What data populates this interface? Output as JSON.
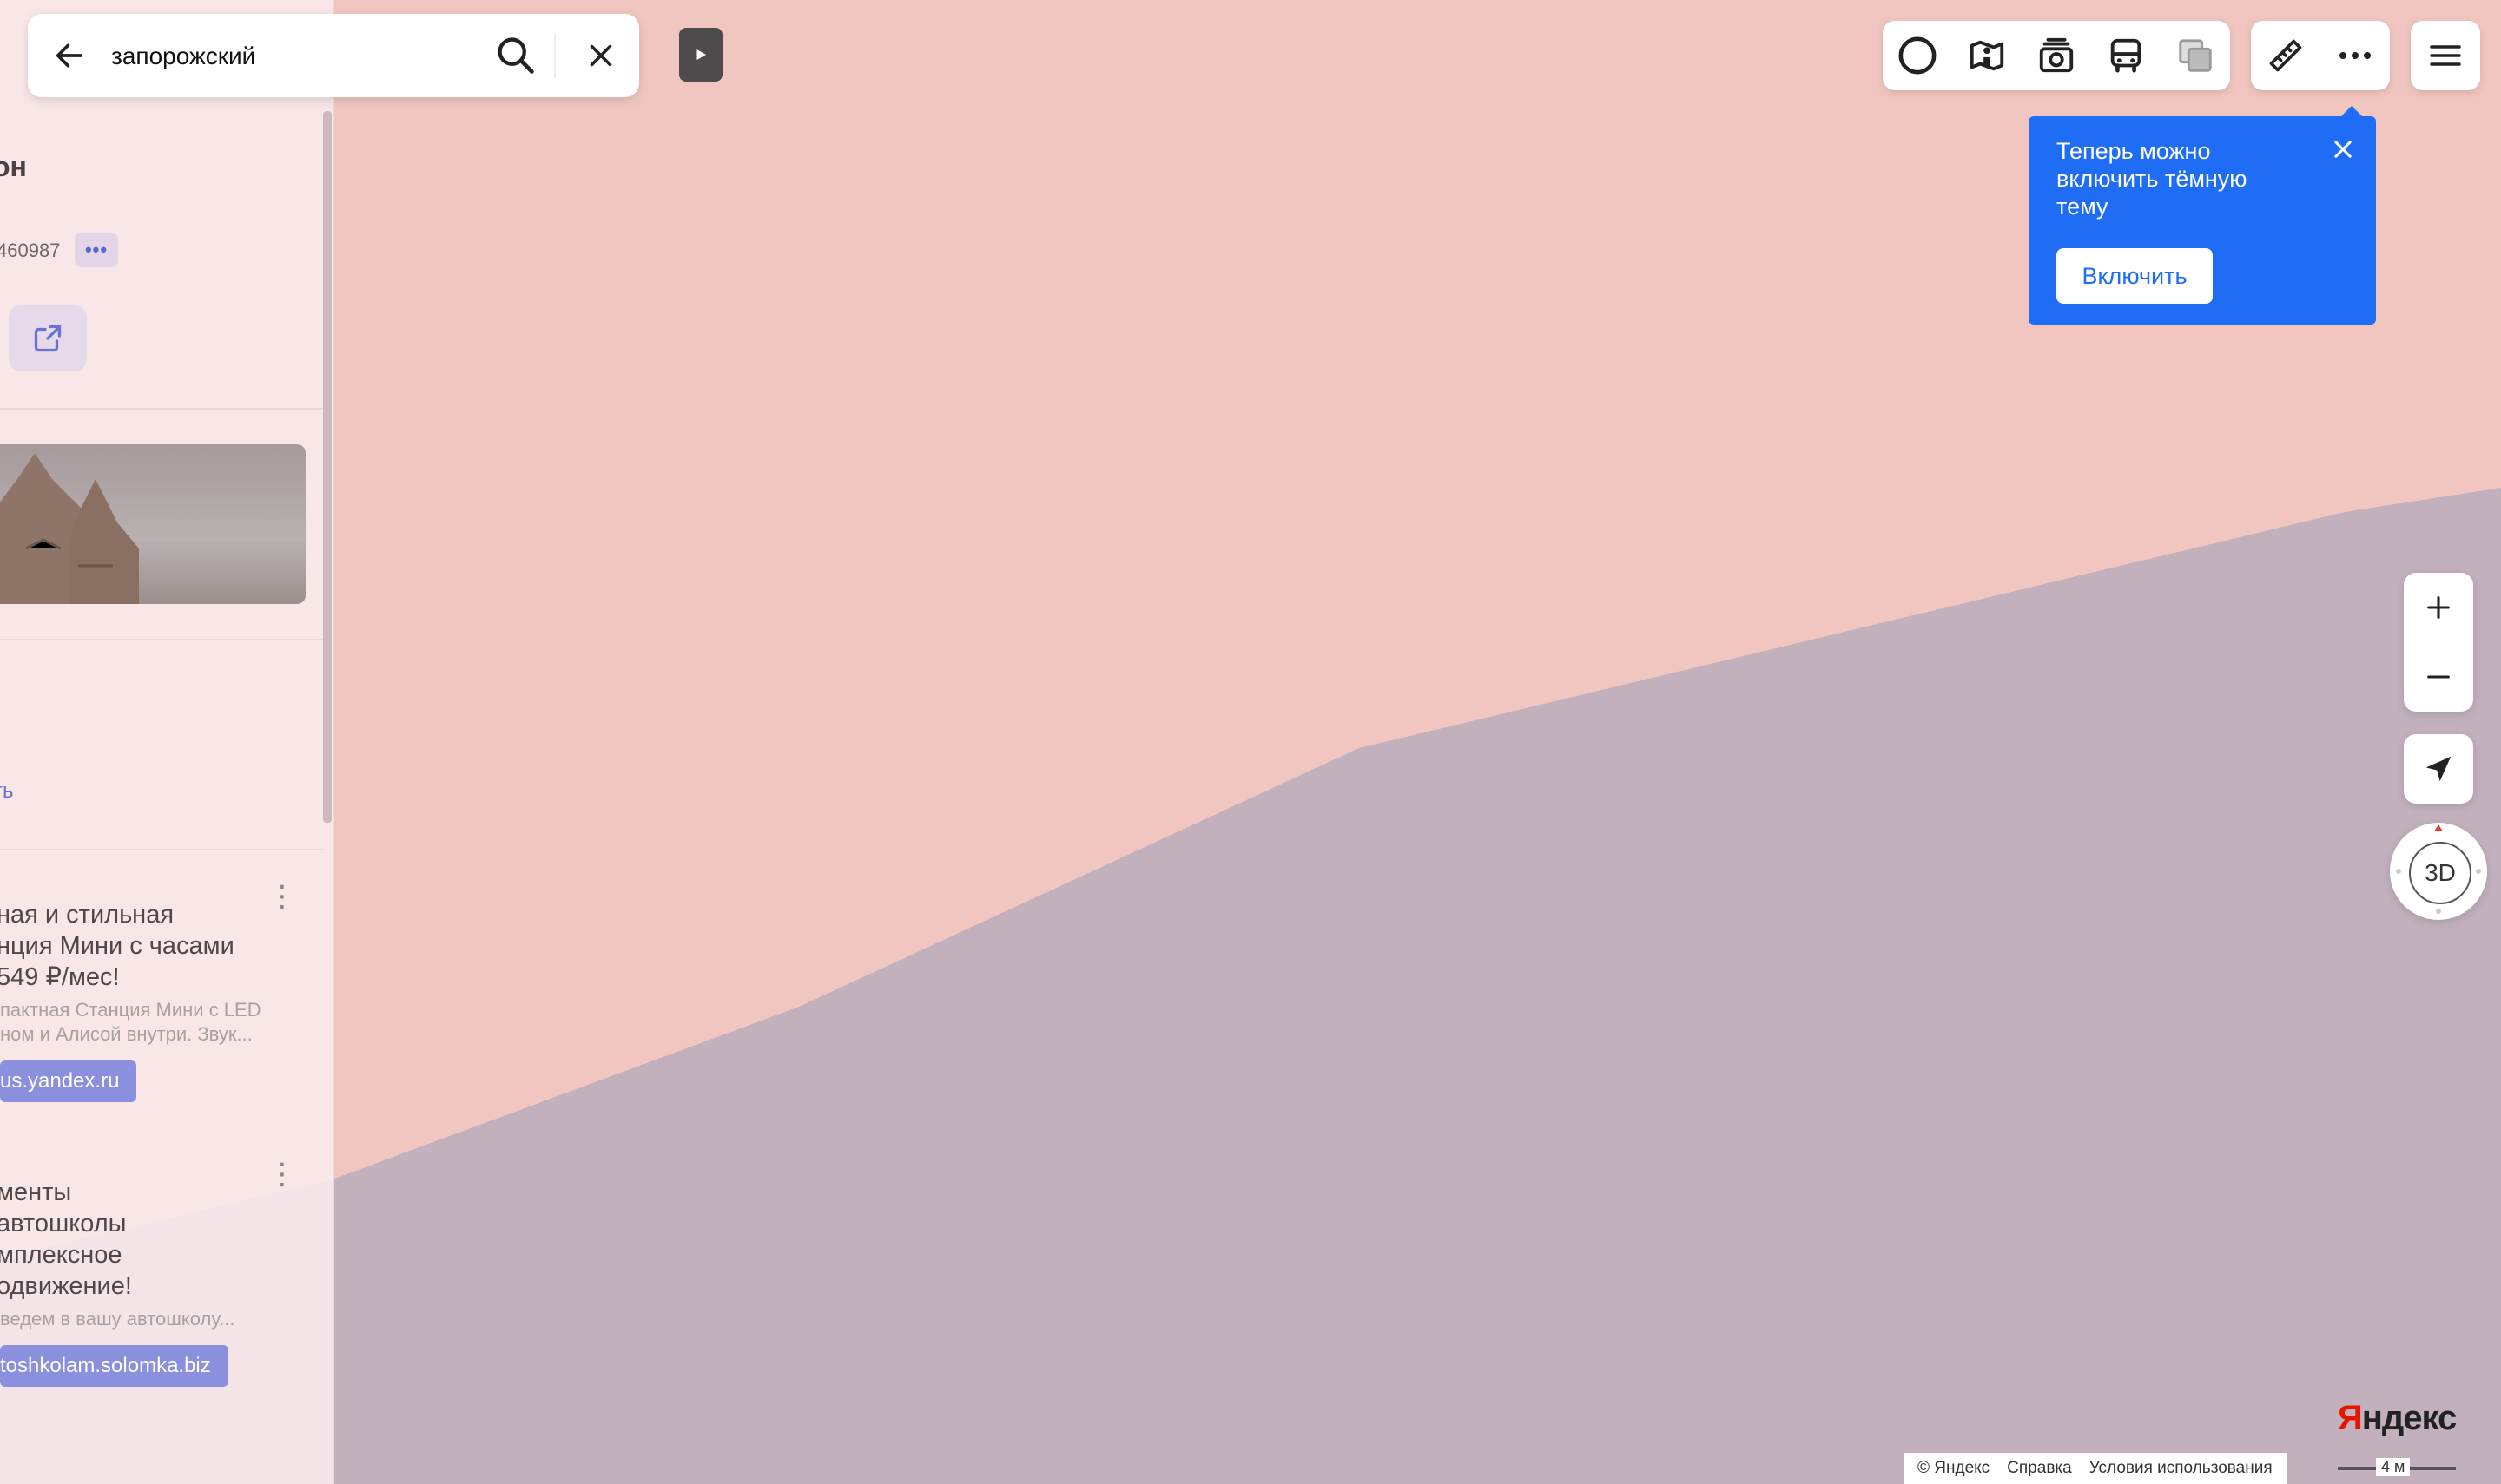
{
  "search": {
    "query": "запорожский",
    "back_label": "назад"
  },
  "panel": {
    "title": "он",
    "phone": "460987",
    "more_dots": "•••",
    "show_link": "ть",
    "ads": [
      {
        "title_lines": [
          "ная и стильная",
          "нция Мини с часами",
          "549 ₽/мес!"
        ],
        "desc_lines": [
          "пактная Станция Мини с LED",
          "ном и Алисой внутри. Звук..."
        ],
        "url": "us.yandex.ru"
      },
      {
        "title_lines": [
          "менты",
          "автошколы",
          "мплексное",
          "одвижение!"
        ],
        "desc_lines": [
          "ведем в вашу автошколу..."
        ],
        "url": "toshkolam.solomka.biz"
      }
    ]
  },
  "toolbar": {
    "layers": [
      "alice-icon",
      "panorama-icon",
      "photo-icon",
      "transport-icon",
      "layers-icon"
    ],
    "tools": [
      "ruler-icon",
      "more-icon"
    ]
  },
  "tooltip": {
    "text": "Теперь можно включить тёмную тему",
    "button": "Включить"
  },
  "compass": {
    "label": "3D"
  },
  "footer": {
    "logo_first": "Я",
    "logo_rest": "ндекс",
    "copyright": "© Яндекс",
    "help": "Справка",
    "terms": "Условия использования",
    "scale": "4 м"
  },
  "colors": {
    "map_pink": "#f1c6c1",
    "map_mauve": "#c2b0bc",
    "accent_blue": "#1f6df5"
  }
}
